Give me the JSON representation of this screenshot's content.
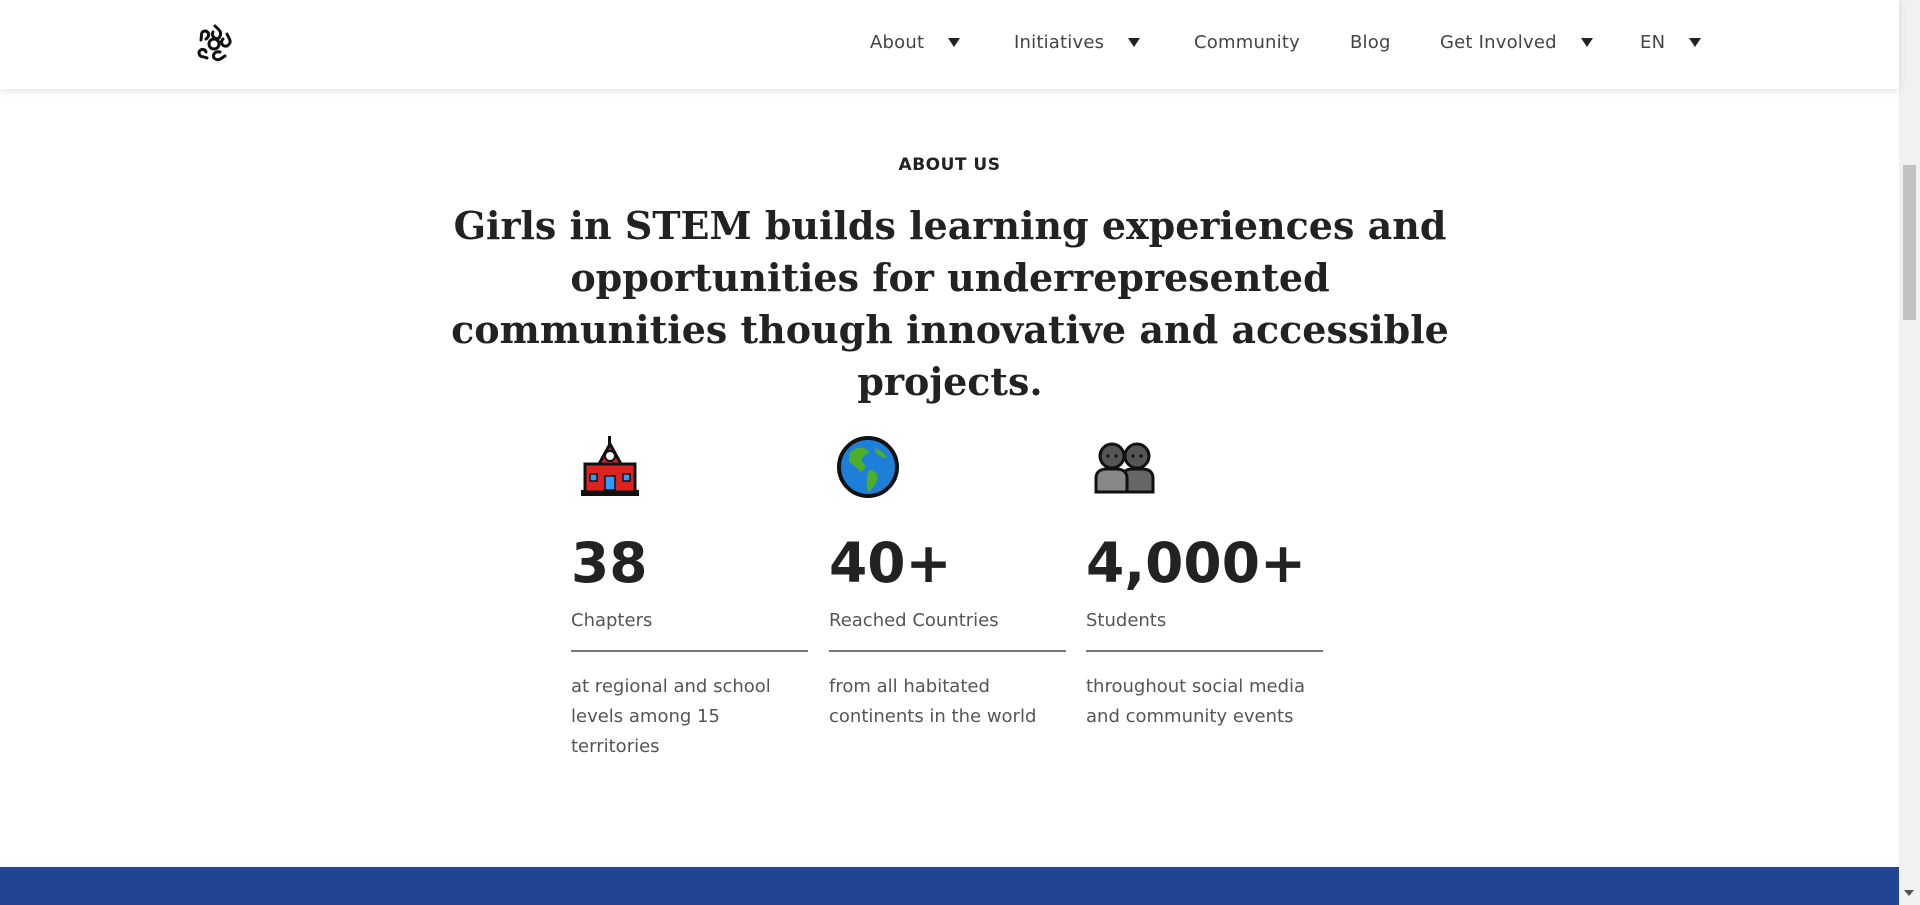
{
  "nav": {
    "items": [
      {
        "label": "About",
        "dropdown": true
      },
      {
        "label": "Initiatives",
        "dropdown": true
      },
      {
        "label": "Community",
        "dropdown": false
      },
      {
        "label": "Blog",
        "dropdown": false
      },
      {
        "label": "Get Involved",
        "dropdown": true
      },
      {
        "label": "EN",
        "dropdown": true
      }
    ]
  },
  "about": {
    "eyebrow": "ABOUT US",
    "headline": "Girls in STEM builds learning experiences and opportunities for underrepresented communities though innovative and accessible projects.",
    "stats": [
      {
        "icon": "school-icon",
        "value": "38",
        "label": "Chapters",
        "desc": "at regional and school levels among 15 territories"
      },
      {
        "icon": "globe-americas-icon",
        "value": "40+",
        "label": "Reached Countries",
        "desc": "from all habitated continents in the world"
      },
      {
        "icon": "people-icon",
        "value": "4,000+",
        "label": "Students",
        "desc": "throughout social media and community events"
      }
    ]
  },
  "colors": {
    "footer_band": "#214593",
    "text_dark": "#222222",
    "text_muted": "#555555"
  }
}
